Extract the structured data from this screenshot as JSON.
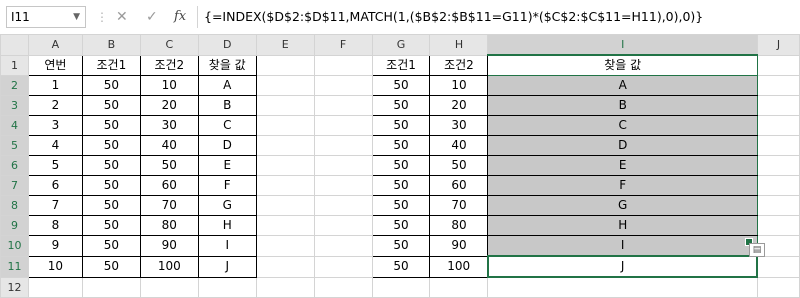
{
  "name_box": "I11",
  "fx_label": "fx",
  "formula": "{=INDEX($D$2:$D$11,MATCH(1,($B$2:$B$11=G11)*($C$2:$C$11=H11),0),0)}",
  "columns": [
    "A",
    "B",
    "C",
    "D",
    "E",
    "F",
    "G",
    "H",
    "I",
    "J"
  ],
  "rows": [
    "1",
    "2",
    "3",
    "4",
    "5",
    "6",
    "7",
    "8",
    "9",
    "10",
    "11",
    "12"
  ],
  "left_table": {
    "headers": [
      "연번",
      "조건1",
      "조건2",
      "찾을 값"
    ],
    "rows": [
      [
        "1",
        "50",
        "10",
        "A"
      ],
      [
        "2",
        "50",
        "20",
        "B"
      ],
      [
        "3",
        "50",
        "30",
        "C"
      ],
      [
        "4",
        "50",
        "40",
        "D"
      ],
      [
        "5",
        "50",
        "50",
        "E"
      ],
      [
        "6",
        "50",
        "60",
        "F"
      ],
      [
        "7",
        "50",
        "70",
        "G"
      ],
      [
        "8",
        "50",
        "80",
        "H"
      ],
      [
        "9",
        "50",
        "90",
        "I"
      ],
      [
        "10",
        "50",
        "100",
        "J"
      ]
    ]
  },
  "right_table": {
    "headers": [
      "조건1",
      "조건2",
      "찾을 값"
    ],
    "rows": [
      [
        "50",
        "10",
        "A"
      ],
      [
        "50",
        "20",
        "B"
      ],
      [
        "50",
        "30",
        "C"
      ],
      [
        "50",
        "40",
        "D"
      ],
      [
        "50",
        "50",
        "E"
      ],
      [
        "50",
        "60",
        "F"
      ],
      [
        "50",
        "70",
        "G"
      ],
      [
        "50",
        "80",
        "H"
      ],
      [
        "50",
        "90",
        "I"
      ],
      [
        "50",
        "100",
        "J"
      ]
    ]
  },
  "colors": {
    "accent": "#217346",
    "selection_fill": "#c8c8c8"
  }
}
